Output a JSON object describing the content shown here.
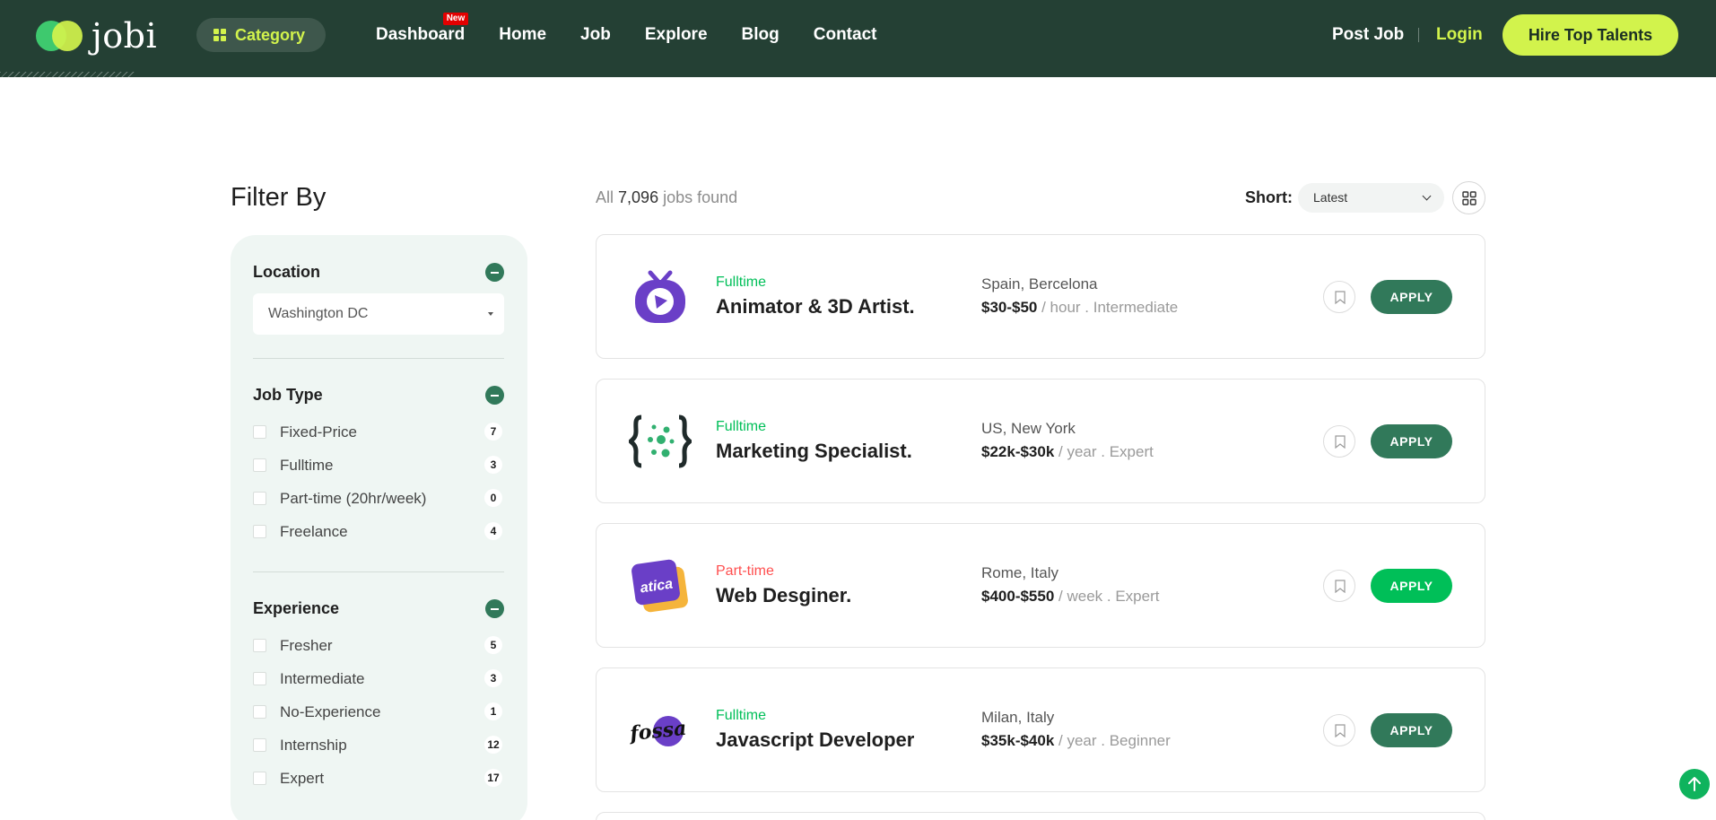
{
  "brand": {
    "name": "jobi"
  },
  "header": {
    "category_label": "Category",
    "nav": [
      {
        "label": "Dashboard",
        "badge": "New"
      },
      {
        "label": "Home"
      },
      {
        "label": "Job"
      },
      {
        "label": "Explore"
      },
      {
        "label": "Blog"
      },
      {
        "label": "Contact"
      }
    ],
    "post_job": "Post Job",
    "login": "Login",
    "hire_button": "Hire Top Talents"
  },
  "sidebar": {
    "title": "Filter By",
    "location": {
      "title": "Location",
      "value": "Washington DC"
    },
    "job_type": {
      "title": "Job Type",
      "options": [
        {
          "label": "Fixed-Price",
          "count": "7"
        },
        {
          "label": "Fulltime",
          "count": "3"
        },
        {
          "label": "Part-time (20hr/week)",
          "count": "0"
        },
        {
          "label": "Freelance",
          "count": "4"
        }
      ]
    },
    "experience": {
      "title": "Experience",
      "options": [
        {
          "label": "Fresher",
          "count": "5"
        },
        {
          "label": "Intermediate",
          "count": "3"
        },
        {
          "label": "No-Experience",
          "count": "1"
        },
        {
          "label": "Internship",
          "count": "12"
        },
        {
          "label": "Expert",
          "count": "17"
        }
      ]
    }
  },
  "results": {
    "found_prefix": "All",
    "found_count": "7,096",
    "found_suffix": "jobs found",
    "sort_label": "Short:",
    "sort_value": "Latest"
  },
  "jobs": [
    {
      "type": "Fulltime",
      "title": "Animator & 3D Artist.",
      "location": "Spain, Bercelona",
      "salary": "$30-$50",
      "salary_rest": " / hour . Intermediate",
      "apply_label": "APPLY",
      "logo": "tv-icon"
    },
    {
      "type": "Fulltime",
      "title": "Marketing Specialist.",
      "location": "US, New York",
      "salary": "$22k-$30k",
      "salary_rest": " / year . Expert",
      "apply_label": "APPLY",
      "logo": "braces-dots-icon"
    },
    {
      "type": "Part-time",
      "title": "Web Desginer.",
      "location": "Rome, Italy",
      "salary": "$400-$550",
      "salary_rest": " / week . Expert",
      "apply_label": "APPLY",
      "logo": "atica-logo",
      "logo_text": "atica"
    },
    {
      "type": "Fulltime",
      "title": "Javascript Developer",
      "location": "Milan, Italy",
      "salary": "$35k-$40k",
      "salary_rest": " / year . Beginner",
      "apply_label": "APPLY",
      "logo": "fossa-logo",
      "logo_text": "fossa"
    }
  ],
  "colors": {
    "header_bg": "#244034",
    "accent_lime": "#d2f34c",
    "brand_green": "#31795a",
    "fulltime": "#00bf58",
    "parttime": "#ff4f4f",
    "apply_active": "#00bf58",
    "panel_bg": "#eff6f3"
  }
}
